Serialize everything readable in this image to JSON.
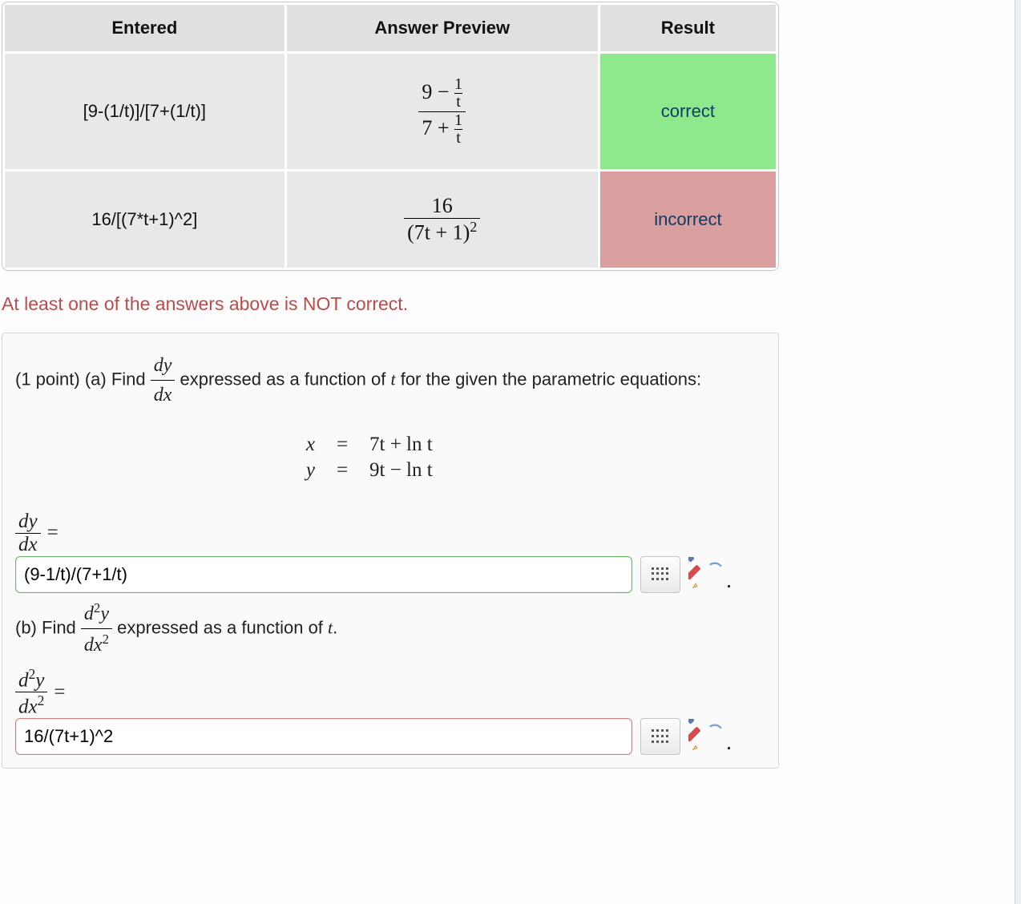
{
  "results_table": {
    "headers": [
      "Entered",
      "Answer Preview",
      "Result"
    ],
    "rows": [
      {
        "entered": "[9-(1/t)]/[7+(1/t)]",
        "preview": {
          "num_left": "9",
          "num_op": "−",
          "num_frac_top": "1",
          "num_frac_bot": "t",
          "den_left": "7",
          "den_op": "+",
          "den_frac_top": "1",
          "den_frac_bot": "t"
        },
        "result_label": "correct",
        "result_state": "correct"
      },
      {
        "entered": "16/[(7*t+1)^2]",
        "preview2": {
          "num": "16",
          "den": "(7t + 1)",
          "exp": "2"
        },
        "result_label": "incorrect",
        "result_state": "incorrect"
      }
    ]
  },
  "error_message": "At least one of the answers above is NOT correct.",
  "problem": {
    "intro_a_prefix": "(1 point) (a) Find ",
    "intro_a_suffix": " expressed as a function of ",
    "intro_a_var": "t",
    "intro_a_tail": " for the given the parametric equations:",
    "dydx_num": "dy",
    "dydx_den": "dx",
    "param_eq": {
      "x_lhs": "x",
      "x_rhs": "7t + ln t",
      "y_lhs": "y",
      "y_rhs": "9t − ln t"
    },
    "answer_a_label_num": "dy",
    "answer_a_label_den": "dx",
    "answer_a_value": "(9-1/t)/(7+1/t)",
    "intro_b_prefix": "(b) Find ",
    "intro_b_suffix": " expressed as a function of ",
    "intro_b_var": "t",
    "intro_b_tail": ".",
    "d2ydx2_num": "d²y",
    "d2ydx2_den": "dx²",
    "answer_b_label_num": "d²y",
    "answer_b_label_den": "dx²",
    "answer_b_value": "16/(7t+1)^2"
  },
  "icons": {
    "grid": "grid-icon",
    "pencil": "pencil-icon"
  },
  "colors": {
    "correct_bg": "#8ee88c",
    "incorrect_bg": "#d99e9e",
    "error_text": "#bb4a4a"
  }
}
